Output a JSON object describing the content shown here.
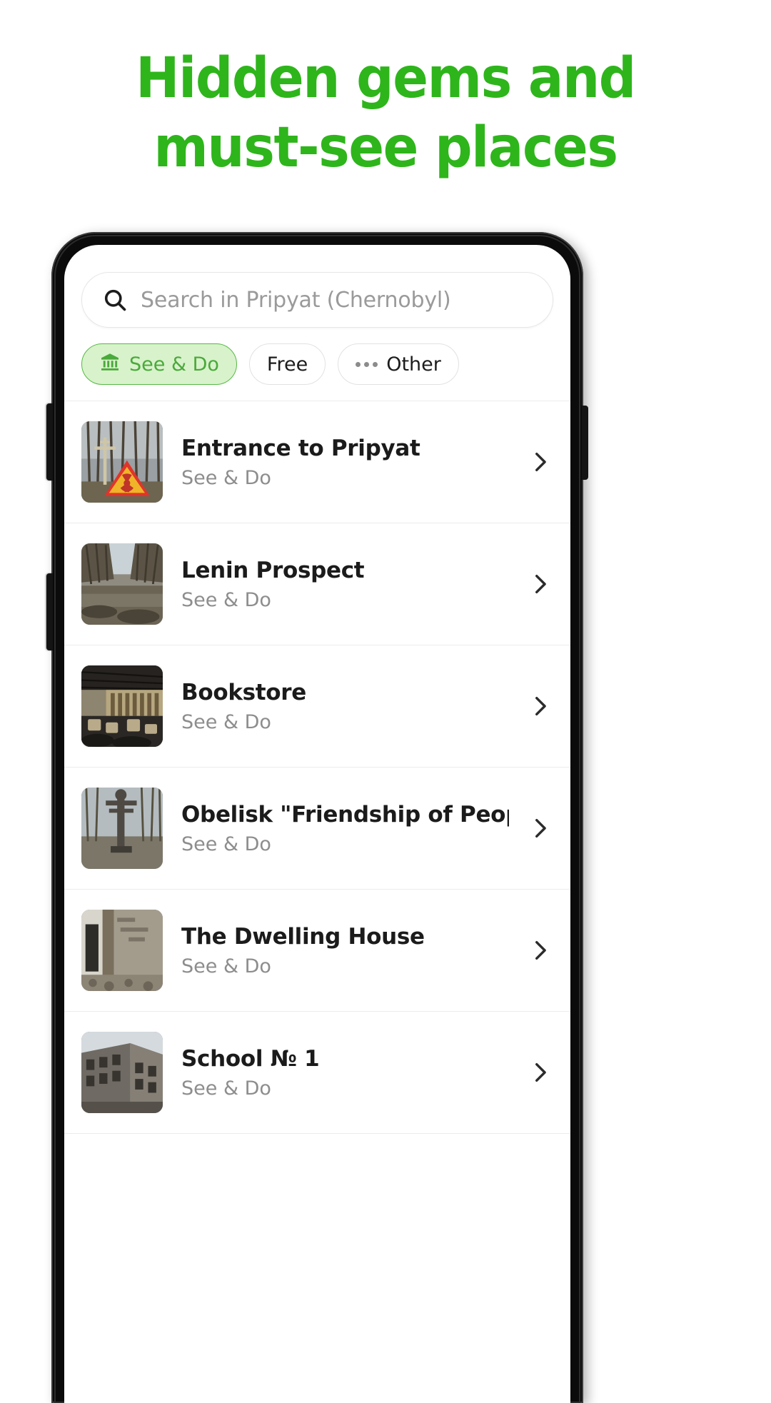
{
  "headline": {
    "line1": "Hidden gems and",
    "line2": "must-see places",
    "color": "#2EB51B"
  },
  "search": {
    "placeholder": "Search in Pripyat (Chernobyl)",
    "icon": "search-icon"
  },
  "filters": [
    {
      "label": "See & Do",
      "icon": "museum-icon",
      "active": true,
      "accent": "#4aa93b"
    },
    {
      "label": "Free",
      "icon": "",
      "active": false,
      "accent": "#1c1c1c"
    },
    {
      "label": "Other",
      "icon": "ellipsis-icon",
      "active": false,
      "accent": "#1c1c1c"
    }
  ],
  "places": [
    {
      "title": "Entrance to Pripyat",
      "category": "See & Do"
    },
    {
      "title": "Lenin Prospect",
      "category": "See & Do"
    },
    {
      "title": "Bookstore",
      "category": "See & Do"
    },
    {
      "title": "Obelisk \"Friendship of Peoples\"",
      "category": "See & Do"
    },
    {
      "title": "The Dwelling House",
      "category": "See & Do"
    },
    {
      "title": "School № 1",
      "category": "See & Do"
    }
  ]
}
